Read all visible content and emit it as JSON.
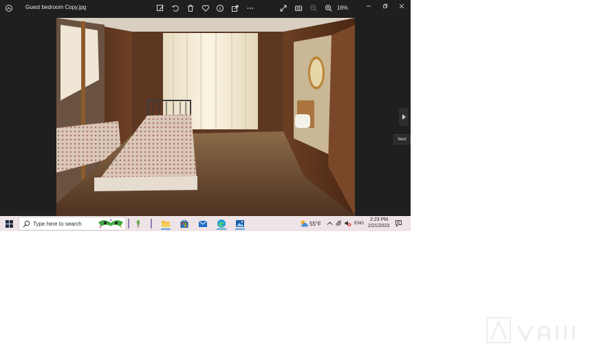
{
  "window": {
    "title": "Guest bedroom Copy.jpg",
    "zoom": "16%"
  },
  "toolbar": {
    "icons": [
      "edit-image-icon",
      "rotate-icon",
      "delete-icon",
      "favorite-icon",
      "info-icon",
      "share-icon",
      "more-icon"
    ]
  },
  "view_controls": [
    "full-screen-icon",
    "fit-window-icon",
    "zoom-out-icon",
    "zoom-in-icon"
  ],
  "window_controls": [
    "minimize-icon",
    "maximize-icon",
    "close-icon"
  ],
  "navigation": {
    "next_tooltip": "Next"
  },
  "taskbar": {
    "search_placeholder": "Type here to search",
    "apps": [
      "file-explorer-icon",
      "store-icon",
      "mail-icon",
      "edge-icon",
      "photos-icon"
    ],
    "active_apps": [
      "file-explorer-icon",
      "edge-icon",
      "photos-icon"
    ],
    "weather": "55°F",
    "language": "ENG",
    "time": "2:23 PM",
    "date": "2/21/2023"
  },
  "colors": {
    "app_background": "#1f1f1f",
    "taskbar_background": "#eee3e6",
    "active_indicator": "#5aa0d8"
  }
}
